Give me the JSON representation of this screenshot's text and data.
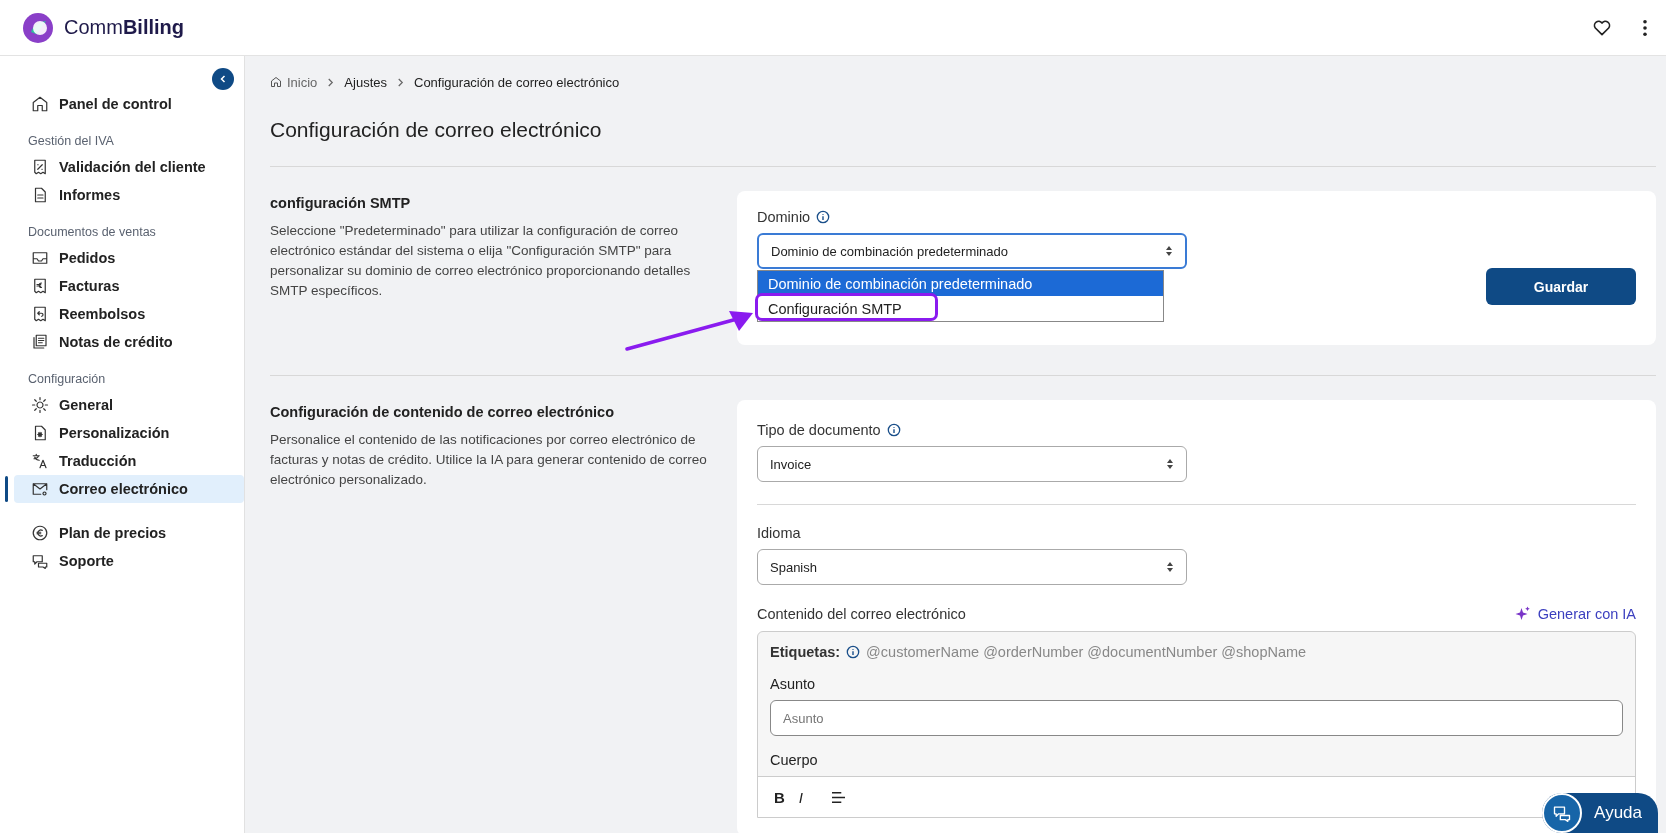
{
  "header": {
    "logo_text_light": "Comm",
    "logo_text_bold": "Billing"
  },
  "sidebar": {
    "groups": [
      {
        "items": [
          {
            "label": "Panel de control",
            "selected": false
          }
        ]
      },
      {
        "heading": "Gestión del IVA",
        "items": [
          {
            "label": "Validación del cliente",
            "selected": false
          },
          {
            "label": "Informes",
            "selected": false
          }
        ]
      },
      {
        "heading": "Documentos de ventas",
        "items": [
          {
            "label": "Pedidos",
            "selected": false
          },
          {
            "label": "Facturas",
            "selected": false
          },
          {
            "label": "Reembolsos",
            "selected": false
          },
          {
            "label": "Notas de crédito",
            "selected": false
          }
        ]
      },
      {
        "heading": "Configuración",
        "items": [
          {
            "label": "General",
            "selected": false
          },
          {
            "label": "Personalización",
            "selected": false
          },
          {
            "label": "Traducción",
            "selected": false
          },
          {
            "label": "Correo electrónico",
            "selected": true
          }
        ]
      },
      {
        "items": [
          {
            "label": "Plan de precios",
            "selected": false
          },
          {
            "label": "Soporte",
            "selected": false
          }
        ]
      }
    ]
  },
  "breadcrumb": [
    "Inicio",
    "Ajustes",
    "Configuración de correo electrónico"
  ],
  "page_title": "Configuración de correo electrónico",
  "smtp_section": {
    "title": "configuración SMTP",
    "description": "Seleccione \"Predeterminado\" para utilizar la configuración de correo electrónico estándar del sistema o elija \"Configuración SMTP\" para personalizar su dominio de correo electrónico proporcionando detalles SMTP específicos.",
    "domain_label": "Dominio",
    "domain_value": "Dominio de combinación predeterminado",
    "options": [
      {
        "label": "Dominio de combinación predeterminado",
        "selected": true,
        "highlighted": false
      },
      {
        "label": "Configuración SMTP",
        "selected": false,
        "highlighted": true
      }
    ],
    "save_button": "Guardar"
  },
  "content_section": {
    "title": "Configuración de contenido de correo electrónico",
    "description": "Personalice el contenido de las notificaciones por correo electrónico de facturas y notas de crédito. Utilice la IA para generar contenido de correo electrónico personalizado.",
    "document_type_label": "Tipo de documento",
    "document_type_value": "Invoice",
    "language_label": "Idioma",
    "language_value": "Spanish",
    "email_content_label": "Contenido del correo electrónico",
    "generate_button": "Generar con IA",
    "tags_label": "Etiquetas:",
    "tags": "@customerName @orderNumber @documentNumber @shopName",
    "subject_label": "Asunto",
    "subject_placeholder": "Asunto",
    "body_label": "Cuerpo",
    "toolbar": [
      "B",
      "I"
    ]
  },
  "help_button": "Ayuda"
}
